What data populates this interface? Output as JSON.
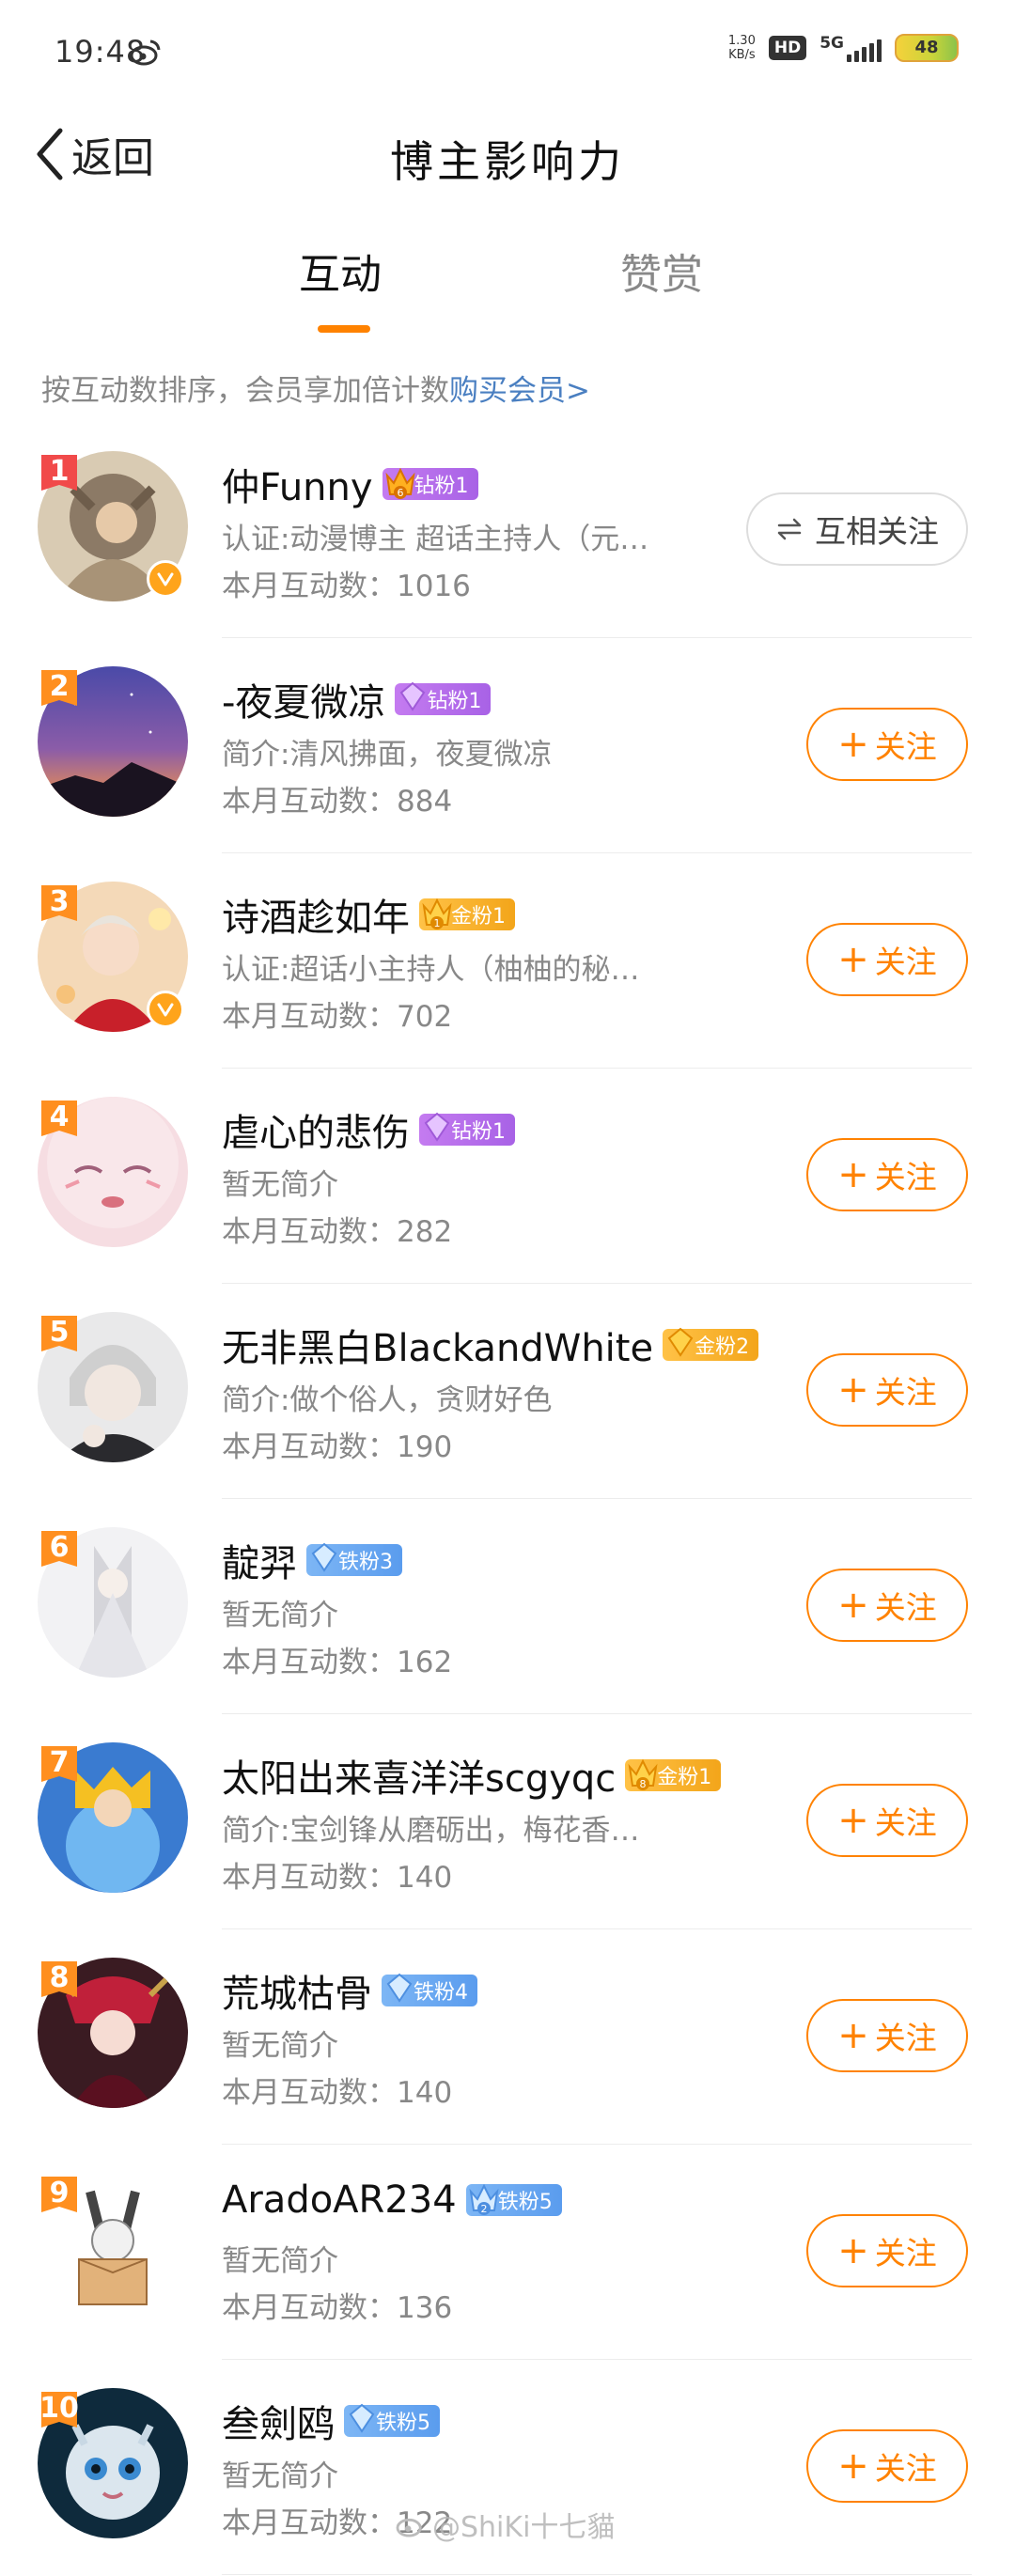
{
  "status_bar": {
    "time": "19:48",
    "speed_value": "1.30",
    "speed_unit": "KB/s",
    "hd": "HD",
    "network": "5G",
    "battery": "48"
  },
  "nav": {
    "back_label": "返回",
    "title": "博主影响力"
  },
  "tabs": [
    {
      "label": "互动"
    },
    {
      "label": "赞赏"
    }
  ],
  "sort_hint": {
    "text": "按互动数排序，会员享加倍计数",
    "link": "购买会员>"
  },
  "colors": {
    "accent": "#ff8200",
    "link": "#4a7fc1",
    "rank_top": "#f14a4a",
    "rank_other": "#ff8f1f"
  },
  "users": [
    {
      "rank": "1",
      "name": "仲Funny",
      "badge": "钻粉1",
      "badge_tier": "6",
      "desc": "认证:动漫博主 超话主持人（元…",
      "count": "本月互动数：1016",
      "button": "互相关注",
      "verified": true
    },
    {
      "rank": "2",
      "name": "-夜夏微凉",
      "badge": "钻粉1",
      "badge_tier": "",
      "desc": "简介:清风拂面，夜夏微凉",
      "count": "本月互动数：884",
      "button": "关注",
      "verified": false
    },
    {
      "rank": "3",
      "name": "诗酒趁如年",
      "badge": "金粉1",
      "badge_tier": "1",
      "desc": "认证:超话小主持人（柚柚的秘…",
      "count": "本月互动数：702",
      "button": "关注",
      "verified": true
    },
    {
      "rank": "4",
      "name": "虐心的悲伤",
      "badge": "钻粉1",
      "badge_tier": "",
      "desc": "暂无简介",
      "count": "本月互动数：282",
      "button": "关注",
      "verified": false
    },
    {
      "rank": "5",
      "name": "无非黑白BlackandWhite",
      "badge": "金粉2",
      "badge_tier": "",
      "desc": "简介:做个俗人，贪财好色",
      "count": "本月互动数：190",
      "button": "关注",
      "verified": false
    },
    {
      "rank": "6",
      "name": "靛羿",
      "badge": "铁粉3",
      "badge_tier": "",
      "desc": "暂无简介",
      "count": "本月互动数：162",
      "button": "关注",
      "verified": false
    },
    {
      "rank": "7",
      "name": "太阳出来喜洋洋scgyqc",
      "badge": "金粉1",
      "badge_tier": "8",
      "desc": "简介:宝剑锋从磨砺出，梅花香…",
      "count": "本月互动数：140",
      "button": "关注",
      "verified": false
    },
    {
      "rank": "8",
      "name": "荒城枯骨",
      "badge": "铁粉4",
      "badge_tier": "",
      "desc": "暂无简介",
      "count": "本月互动数：140",
      "button": "关注",
      "verified": false
    },
    {
      "rank": "9",
      "name": "AradoAR234",
      "badge": "铁粉5",
      "badge_tier": "2",
      "desc": "暂无简介",
      "count": "本月互动数：136",
      "button": "关注",
      "verified": false
    },
    {
      "rank": "10",
      "name": "叁劍鸥",
      "badge": "铁粉5",
      "badge_tier": "",
      "desc": "暂无简介",
      "count": "本月互动数：122",
      "button": "关注",
      "verified": false
    }
  ],
  "watermark": "@ShiKi十七貓"
}
